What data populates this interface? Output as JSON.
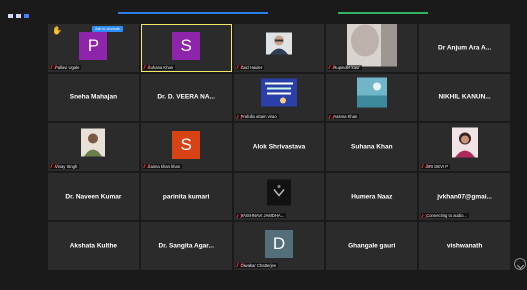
{
  "ask_to_unmute": "Ask to Unmute",
  "tiles": [
    {
      "type": "avatar",
      "letter": "P",
      "color": "#8e24aa",
      "label": "Pallavi Ugale",
      "hand": true
    },
    {
      "type": "avatar",
      "letter": "S",
      "color": "#8e24aa",
      "label": "Suhana Khan",
      "active": true
    },
    {
      "type": "photo",
      "photo": "person-with-glasses",
      "label": "Zaid Haider"
    },
    {
      "type": "photo",
      "photo": "blurred-portrait",
      "label": "Rupinder kaur"
    },
    {
      "type": "name",
      "name": "Dr Anjum Ara A..."
    },
    {
      "type": "name",
      "name": "Sneha Mahajan"
    },
    {
      "type": "name",
      "name": "Dr. D. VEERA NA..."
    },
    {
      "type": "photo",
      "photo": "quote-card",
      "label": "Prafulla uttam virao"
    },
    {
      "type": "photo",
      "photo": "teal-landscape",
      "label": "Aasma Khan"
    },
    {
      "type": "name",
      "name": "NIKHIL KANUN..."
    },
    {
      "type": "photo",
      "photo": "man-portrait",
      "label": "Vinay Singh"
    },
    {
      "type": "avatar",
      "letter": "S",
      "color": "#d84315",
      "label": "Saima khan khan"
    },
    {
      "type": "name",
      "name": "Alok Shrivastava"
    },
    {
      "type": "name",
      "name": "Suhana Khan"
    },
    {
      "type": "photo",
      "photo": "woman-portrait",
      "label": "SRI DEVI P"
    },
    {
      "type": "name",
      "name": "Dr. Naveen Kumar"
    },
    {
      "type": "name",
      "name": "parinita kumari"
    },
    {
      "type": "photo",
      "photo": "dark-logo",
      "label": "VAISHNAVI JAMDHA..."
    },
    {
      "type": "name",
      "name": "Humera Naaz"
    },
    {
      "type": "name",
      "name": "jvkhan07@gmai...",
      "label": "Connecting to audio..."
    },
    {
      "type": "name",
      "name": "Akshata Kulthe"
    },
    {
      "type": "name",
      "name": "Dr. Sangita Agar..."
    },
    {
      "type": "avatar",
      "letter": "D",
      "color": "#546e7a",
      "label": "Diwakar Chatterjee"
    },
    {
      "type": "name",
      "name": "Ghangale gauri"
    },
    {
      "type": "name",
      "name": "vishwanath"
    }
  ]
}
